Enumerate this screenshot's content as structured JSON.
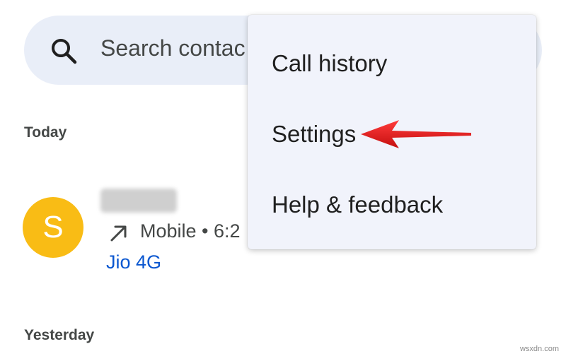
{
  "search": {
    "placeholder": "Search contacts",
    "visible_text": "Search contac"
  },
  "recents": {
    "today_label": "Today",
    "yesterday_label": "Yesterday",
    "calls": [
      {
        "avatar_letter": "S",
        "avatar_color": "#f9bc15",
        "name_blurred": true,
        "call_type_icon": "outgoing-call-arrow-icon",
        "meta": "Mobile • 6:2",
        "carrier": "Jio 4G"
      }
    ]
  },
  "menu": {
    "items": [
      {
        "label": "Call history"
      },
      {
        "label": "Settings"
      },
      {
        "label": "Help & feedback"
      }
    ]
  },
  "annotation": {
    "pointer_target": "Settings",
    "color": "#e01616"
  },
  "watermark": "wsxdn.com",
  "colors": {
    "search_bg": "#e9eef8",
    "menu_bg": "#f1f3fb",
    "link": "#0b57d0"
  }
}
